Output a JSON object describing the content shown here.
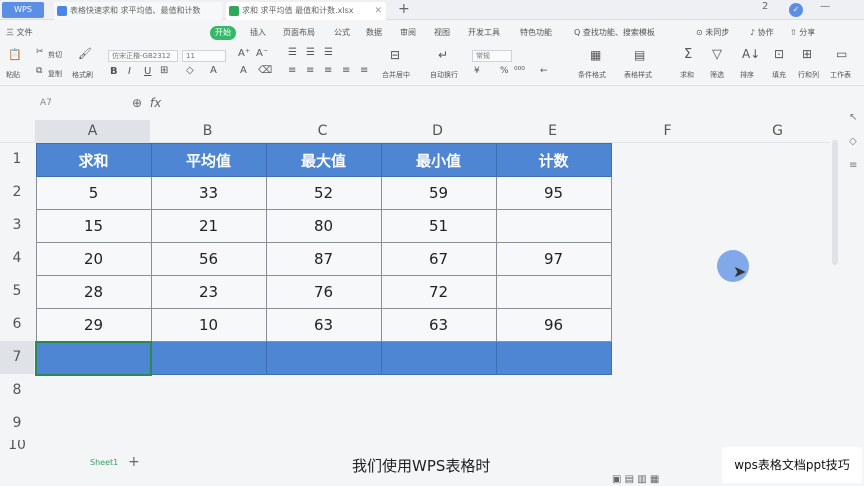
{
  "titlebar": {
    "wps_label": "WPS",
    "tab1_label": "表格快速求和 求平均值、最值和计数",
    "tab2_label": "求和 求平均值 最值和计数.xlsx",
    "right_1": "2",
    "right_2": "—"
  },
  "menubar": {
    "file": "三 文件",
    "start": "开始",
    "items": [
      "插入",
      "页面布局",
      "公式",
      "数据",
      "审阅",
      "视图",
      "开发工具",
      "特色功能"
    ],
    "search": "Q 查找功能、搜索模板",
    "right": [
      "⊙ 未同步",
      "♪ 协作",
      "⇧ 分享"
    ]
  },
  "toolbar": {
    "paste": "粘贴",
    "cut": "剪切",
    "copy": "复制",
    "format_painter": "格式刷",
    "font_name": "仿宋正楷-GB2312",
    "font_size": "11",
    "merge": "合并居中",
    "wrap": "自动换行",
    "number_format": "常规",
    "cond_format": "条件格式",
    "table_style": "表格样式",
    "sum": "求和",
    "filter": "筛选",
    "sort": "排序",
    "fill": "填充",
    "row_col": "行和列",
    "worksheet": "工作表"
  },
  "formula": {
    "namebox": "A7",
    "fx": "fx"
  },
  "grid": {
    "columns": [
      "A",
      "B",
      "C",
      "D",
      "E",
      "F",
      "G"
    ],
    "rows": [
      "1",
      "2",
      "3",
      "4",
      "5",
      "6",
      "7",
      "8",
      "9",
      "10"
    ],
    "header": [
      "求和",
      "平均值",
      "最大值",
      "最小值",
      "计数"
    ],
    "data": [
      [
        "5",
        "33",
        "52",
        "59",
        "95"
      ],
      [
        "15",
        "21",
        "80",
        "51",
        ""
      ],
      [
        "20",
        "56",
        "87",
        "67",
        "97"
      ],
      [
        "28",
        "23",
        "76",
        "72",
        ""
      ],
      [
        "29",
        "10",
        "63",
        "63",
        "96"
      ],
      [
        "",
        "",
        "",
        "",
        ""
      ]
    ]
  },
  "bottom": {
    "sheet_name": "Sheet1",
    "add": "+",
    "subtitle": "我们使用WPS表格时",
    "brand": "wps表格文档ppt技巧"
  },
  "colors": {
    "accent": "#4f86d3",
    "start_green": "#35b86a",
    "selection": "#2b8a52"
  }
}
